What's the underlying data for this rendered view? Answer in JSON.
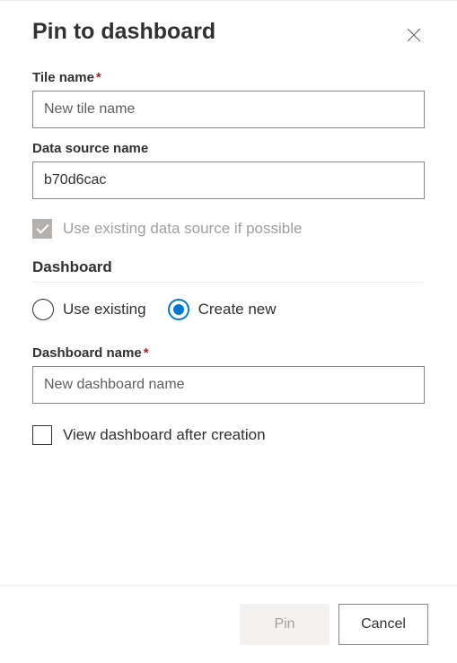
{
  "dialog": {
    "title": "Pin to dashboard"
  },
  "tileName": {
    "label": "Tile name",
    "placeholder": "New tile name",
    "value": ""
  },
  "dataSourceName": {
    "label": "Data source name",
    "value": "b70d6cac"
  },
  "useExistingDataSource": {
    "label": "Use existing data source if possible",
    "checked": true,
    "disabled": true
  },
  "dashboardSection": {
    "heading": "Dashboard",
    "options": {
      "useExisting": "Use existing",
      "createNew": "Create new"
    },
    "selected": "createNew"
  },
  "dashboardName": {
    "label": "Dashboard name",
    "placeholder": "New dashboard name",
    "value": ""
  },
  "viewAfterCreation": {
    "label": "View dashboard after creation",
    "checked": false
  },
  "buttons": {
    "pin": "Pin",
    "cancel": "Cancel"
  }
}
